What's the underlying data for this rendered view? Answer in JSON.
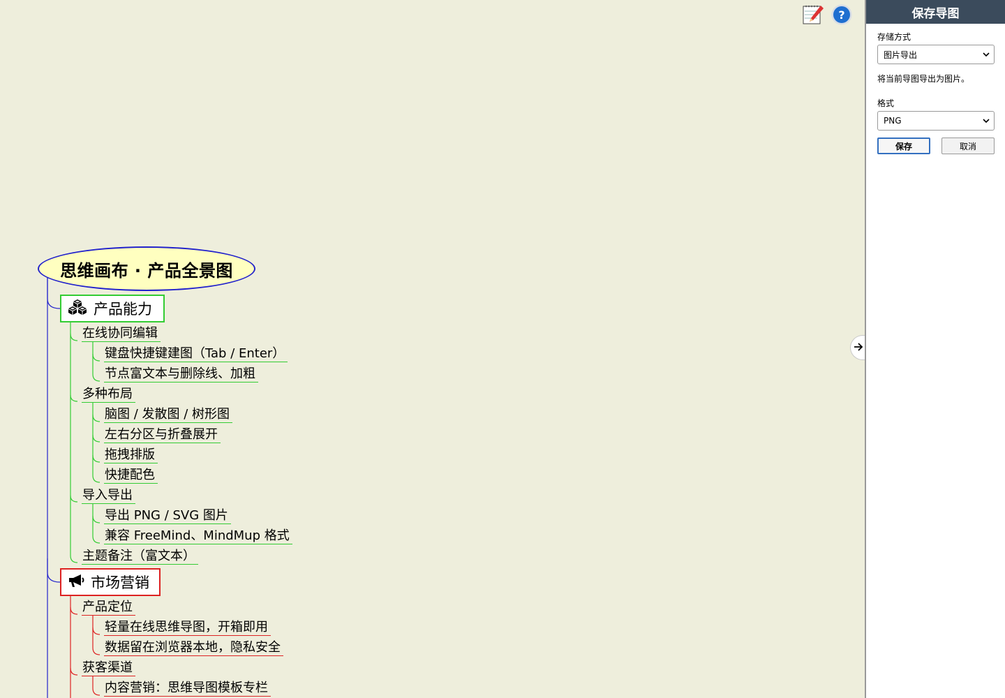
{
  "mindmap": {
    "root": {
      "title": "思维画布 · 产品全景图"
    },
    "branches": [
      {
        "key": "product",
        "color": "#33cc33",
        "icon": "cubes-icon",
        "title": "产品能力",
        "groups": [
          {
            "title": "在线协同编辑",
            "items": [
              "键盘快捷键建图（Tab / Enter）",
              "节点富文本与删除线、加粗"
            ]
          },
          {
            "title": "多种布局",
            "items": [
              "脑图 / 发散图 / 树形图",
              "左右分区与折叠展开",
              "拖拽排版",
              "快捷配色"
            ]
          },
          {
            "title": "导入导出",
            "items": [
              "导出 PNG / SVG 图片",
              "兼容 FreeMind、MindMup 格式"
            ]
          },
          {
            "title": "主题备注（富文本）",
            "items": []
          }
        ]
      },
      {
        "key": "marketing",
        "color": "#dd2222",
        "icon": "megaphone-icon",
        "title": "市场营销",
        "groups": [
          {
            "title": "产品定位",
            "items": [
              "轻量在线思维导图，开箱即用",
              "数据留在浏览器本地，隐私安全"
            ]
          },
          {
            "title": "获客渠道",
            "items": [
              "内容营销：思维导图模板专栏"
            ]
          }
        ]
      }
    ]
  },
  "toolbar": {
    "edit_icon": "edit-notes-icon",
    "help_icon": "help-icon"
  },
  "panel": {
    "title": "保存导图",
    "storage_label": "存储方式",
    "storage_value": "图片导出",
    "description": "将当前导图导出为图片。",
    "format_label": "格式",
    "format_value": "PNG",
    "save_label": "保存",
    "cancel_label": "取消"
  },
  "colors": {
    "canvas": "#eeeedc",
    "root_border": "#2222cc",
    "root_fill": "#ffffc0",
    "panel_header": "#3b4b5c",
    "primary_border": "#3470c0"
  }
}
